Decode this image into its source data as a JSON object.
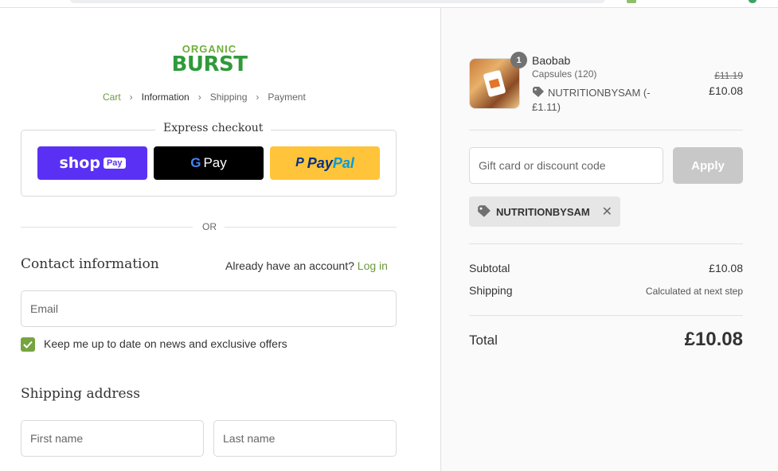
{
  "brand": {
    "line1": "ORGANIC",
    "line2": "BURST"
  },
  "breadcrumb": [
    "Cart",
    "Information",
    "Shipping",
    "Payment"
  ],
  "express": {
    "title": "Express checkout",
    "shoppay_text": "shop",
    "shoppay_badge": "Pay",
    "gpay_g": "G",
    "gpay_text": "Pay",
    "paypal_p": "P",
    "paypal_text1": "Pay",
    "paypal_text2": "Pal"
  },
  "or_text": "OR",
  "contact": {
    "heading": "Contact information",
    "account_prompt": "Already have an account?",
    "login_link": "Log in",
    "email_placeholder": "Email",
    "newsletter_label": "Keep me up to date on news and exclusive offers",
    "newsletter_checked": true
  },
  "shipping": {
    "heading": "Shipping address",
    "first_name_placeholder": "First name",
    "last_name_placeholder": "Last name"
  },
  "summary": {
    "product": {
      "name": "Baobab",
      "variant": "Capsules (120)",
      "quantity": "1",
      "discount_note": "NUTRITIONBYSAM (-£1.11)",
      "price_original": "£11.19",
      "price_current": "£10.08"
    },
    "discount_placeholder": "Gift card or discount code",
    "apply_label": "Apply",
    "applied_code": "NUTRITIONBYSAM",
    "remove_symbol": "✕",
    "subtotal_label": "Subtotal",
    "subtotal_value": "£10.08",
    "shipping_label": "Shipping",
    "shipping_value": "Calculated at next step",
    "total_label": "Total",
    "total_value": "£10.08"
  },
  "colors": {
    "accent_green": "#6a9a3e",
    "checkbox_green": "#76a440",
    "shoppay_purple": "#5a31f4",
    "paypal_yellow": "#ffc439"
  }
}
